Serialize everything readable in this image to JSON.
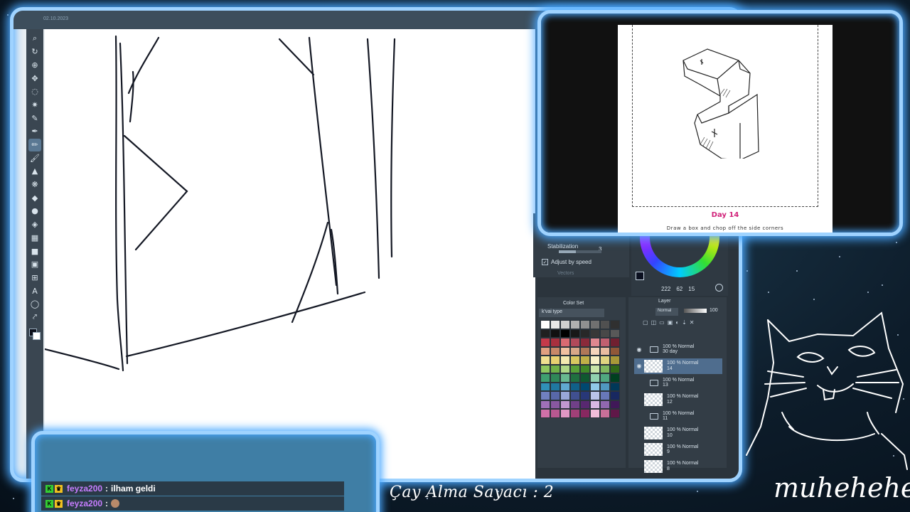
{
  "canvas": {
    "timestamp": "02.10.2023"
  },
  "tools": [
    {
      "name": "zoom-icon",
      "glyph": "⌕"
    },
    {
      "name": "rotate-icon",
      "glyph": "↻"
    },
    {
      "name": "select-layer-icon",
      "glyph": "⊕"
    },
    {
      "name": "move-icon",
      "glyph": "✥"
    },
    {
      "name": "lasso-icon",
      "glyph": "◌"
    },
    {
      "name": "magic-wand-icon",
      "glyph": "✷"
    },
    {
      "name": "eyedropper-icon",
      "glyph": "✎"
    },
    {
      "name": "pen-icon",
      "glyph": "✒"
    },
    {
      "name": "pencil-icon",
      "glyph": "✏"
    },
    {
      "name": "brush-icon",
      "glyph": "🖌"
    },
    {
      "name": "airbrush-icon",
      "glyph": "▲"
    },
    {
      "name": "decoration-icon",
      "glyph": "❋"
    },
    {
      "name": "eraser-icon",
      "glyph": "◆"
    },
    {
      "name": "blend-icon",
      "glyph": "●"
    },
    {
      "name": "fill-icon",
      "glyph": "◈"
    },
    {
      "name": "gradient-icon",
      "glyph": "▦"
    },
    {
      "name": "figure-icon",
      "glyph": "■"
    },
    {
      "name": "frame-border-icon",
      "glyph": "▣"
    },
    {
      "name": "ruler-icon",
      "glyph": "⊞"
    },
    {
      "name": "text-icon",
      "glyph": "A"
    },
    {
      "name": "balloon-icon",
      "glyph": "◯"
    },
    {
      "name": "correct-line-icon",
      "glyph": "⤤"
    }
  ],
  "stabilization": {
    "label": "Stabilization",
    "value": "3",
    "adjust_label": "Adjust by speed",
    "vector_label": "Vectors"
  },
  "color_values": {
    "h": "222",
    "s": "62",
    "v": "15"
  },
  "colorset": {
    "tab_label": "Color Set",
    "set_name": "k'vai type"
  },
  "layer_panel": {
    "tab_label": "Layer",
    "blend_mode": "Normal",
    "opacity": "100",
    "layers": [
      {
        "type": "folder",
        "line1": "100 % Normal",
        "line2": "30 day"
      },
      {
        "type": "layer",
        "line1": "100 % Normal",
        "line2": "14",
        "selected": true
      },
      {
        "type": "folder",
        "line1": "100 % Normal",
        "line2": "13"
      },
      {
        "type": "layer",
        "line1": "100 % Normal",
        "line2": "12"
      },
      {
        "type": "folder",
        "line1": "100 % Normal",
        "line2": "11"
      },
      {
        "type": "layer",
        "line1": "100 % Normal",
        "line2": "10"
      },
      {
        "type": "layer",
        "line1": "100 % Normal",
        "line2": "9"
      },
      {
        "type": "layer",
        "line1": "100 % Normal",
        "line2": "8"
      }
    ]
  },
  "reference": {
    "day_label": "Day 14",
    "caption": "Draw a box and chop off the side corners"
  },
  "chat": [
    {
      "user": "feyza200",
      "message": "ilham geldi",
      "emote": false
    },
    {
      "user": "feyza200",
      "message": "",
      "emote": true
    }
  ],
  "overlay": {
    "counter": "Çay Alma Sayacı : 2",
    "signature": "muhehehe"
  },
  "colors": {
    "frame_glow": "#9fd3ff",
    "chat_user": "#c77dff",
    "day_label": "#d1237a"
  }
}
